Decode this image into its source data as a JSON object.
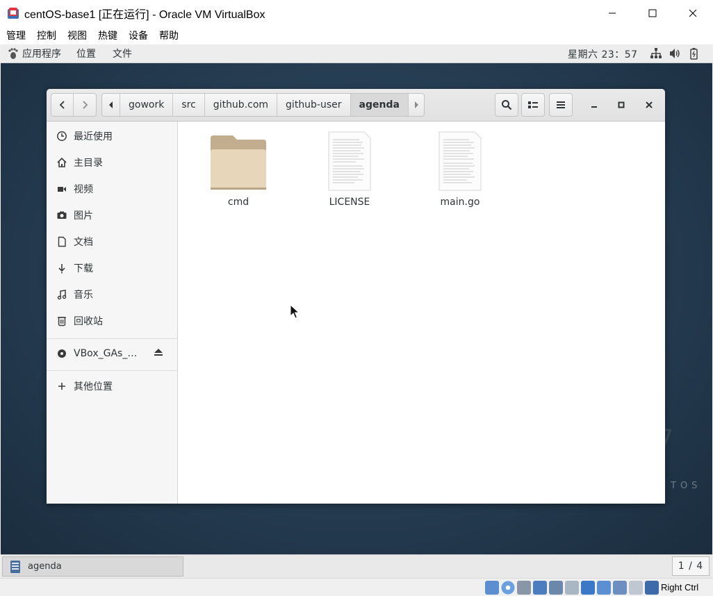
{
  "window": {
    "title": "centOS-base1 [正在运行] - Oracle VM VirtualBox"
  },
  "vbox_menu": [
    "管理",
    "控制",
    "视图",
    "热键",
    "设备",
    "帮助"
  ],
  "gnome_top": {
    "applications": "应用程序",
    "places": "位置",
    "files": "文件",
    "clock": "星期六 23：57"
  },
  "nautilus": {
    "path": [
      {
        "label": "gowork"
      },
      {
        "label": "src"
      },
      {
        "label": "github.com"
      },
      {
        "label": "github-user"
      },
      {
        "label": "agenda"
      }
    ],
    "sidebar": [
      {
        "label": "最近使用",
        "icon": "clock-icon"
      },
      {
        "label": "主目录",
        "icon": "home-icon"
      },
      {
        "label": "视频",
        "icon": "video-icon"
      },
      {
        "label": "图片",
        "icon": "camera-icon"
      },
      {
        "label": "文档",
        "icon": "document-icon"
      },
      {
        "label": "下载",
        "icon": "download-icon"
      },
      {
        "label": "音乐",
        "icon": "music-icon"
      },
      {
        "label": "回收站",
        "icon": "trash-icon"
      }
    ],
    "device": {
      "label": "VBox_GAs_…",
      "icon": "disc-icon"
    },
    "other_locations": "其他位置",
    "files": [
      {
        "name": "cmd",
        "type": "folder"
      },
      {
        "name": "LICENSE",
        "type": "text"
      },
      {
        "name": "main.go",
        "type": "text"
      }
    ]
  },
  "taskbar": {
    "task_label": "agenda",
    "pager": "1 / 4"
  },
  "vbox_status": {
    "host_key": "Right Ctrl"
  },
  "colors": {
    "folder": "#d9c4a3",
    "desktop": "#253c51"
  }
}
